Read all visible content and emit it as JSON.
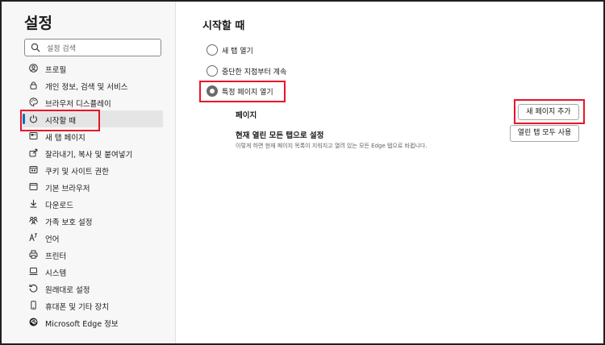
{
  "sidebar": {
    "title": "설정",
    "search_placeholder": "설정 검색",
    "items": [
      {
        "label": "프로필",
        "icon": "profile-icon"
      },
      {
        "label": "개인 정보, 검색 및 서비스",
        "icon": "lock-icon"
      },
      {
        "label": "브라우저 디스플레이",
        "icon": "palette-icon"
      },
      {
        "label": "시작할 때",
        "icon": "power-icon",
        "active": true
      },
      {
        "label": "새 탭 페이지",
        "icon": "new-tab-icon"
      },
      {
        "label": "잘라내기, 복사 및 붙여넣기",
        "icon": "share-icon"
      },
      {
        "label": "쿠키 및 사이트 권한",
        "icon": "site-permissions-icon"
      },
      {
        "label": "기본 브라우저",
        "icon": "browser-icon"
      },
      {
        "label": "다운로드",
        "icon": "download-icon"
      },
      {
        "label": "가족 보호 설정",
        "icon": "family-icon"
      },
      {
        "label": "언어",
        "icon": "language-icon"
      },
      {
        "label": "프린터",
        "icon": "printer-icon"
      },
      {
        "label": "시스템",
        "icon": "system-icon"
      },
      {
        "label": "원래대로 설정",
        "icon": "reset-icon"
      },
      {
        "label": "휴대폰 및 기타 장치",
        "icon": "phone-icon"
      },
      {
        "label": "Microsoft Edge 정보",
        "icon": "edge-icon"
      }
    ]
  },
  "main": {
    "title": "시작할 때",
    "options": [
      {
        "label": "새 탭 열기",
        "selected": false
      },
      {
        "label": "중단한 지점부터 계속",
        "selected": false
      },
      {
        "label": "특정 페이지 열기",
        "selected": true
      }
    ],
    "pages_label": "페이지",
    "add_page_button": "새 페이지 추가",
    "set_tabs_label": "현재 열린 모든 탭으로 설정",
    "set_tabs_desc": "이렇게 하면 현재 페이지 목록이 지워지고 열려 있는 모든 Edge 탭으로 바뀝니다.",
    "use_all_tabs_button": "열린 탭 모두 사용"
  },
  "colors": {
    "accent": "#0f6cbd",
    "highlight": "#e8142a"
  }
}
